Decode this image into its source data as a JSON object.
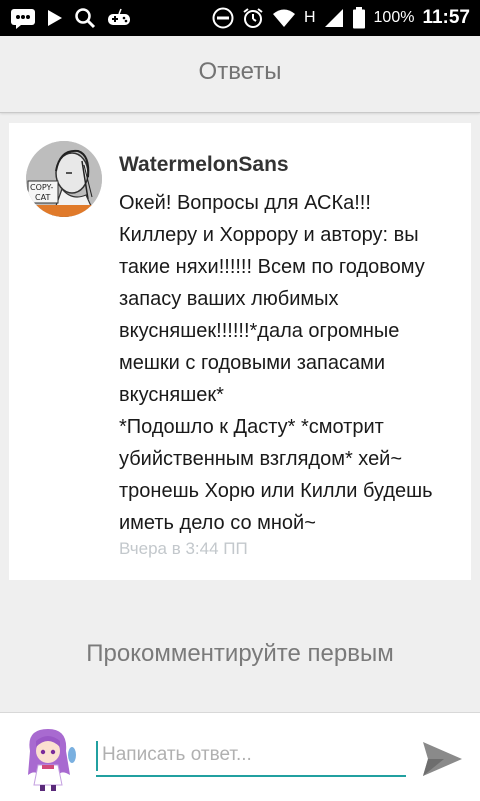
{
  "status_bar": {
    "network": "H",
    "battery": "100%",
    "time": "11:57",
    "icons": [
      "message-icon",
      "play-icon",
      "search-icon",
      "gamepad-icon",
      "minus-circle-icon",
      "alarm-icon",
      "wifi-icon",
      "signal-icon",
      "battery-icon"
    ]
  },
  "header": {
    "title": "Ответы"
  },
  "comment": {
    "author": "WatermelonSans",
    "avatar_text": "COPY-CAT",
    "body_lines": [
      "Окей! Вопросы для АСКа!!!",
      "Киллеру и Хоррору и автору: вы",
      "такие няхи!!!!!! Всем по годовому",
      "запасу ваших любимых",
      "вкусняшек!!!!!!*дала огромные",
      "мешки с годовыми запасами",
      "вкусняшек*",
      "*Подошло к Дасту* *смотрит",
      "убийственным взглядом* хей~",
      "тронешь Хорю или Килли будешь",
      "иметь дело со мной~"
    ],
    "timestamp": "Вчера в 3:44 ПП"
  },
  "empty_state": {
    "text": "Прокомментируйте первым"
  },
  "composer": {
    "placeholder": "Написать ответ...",
    "accent": "#21a0a0"
  }
}
